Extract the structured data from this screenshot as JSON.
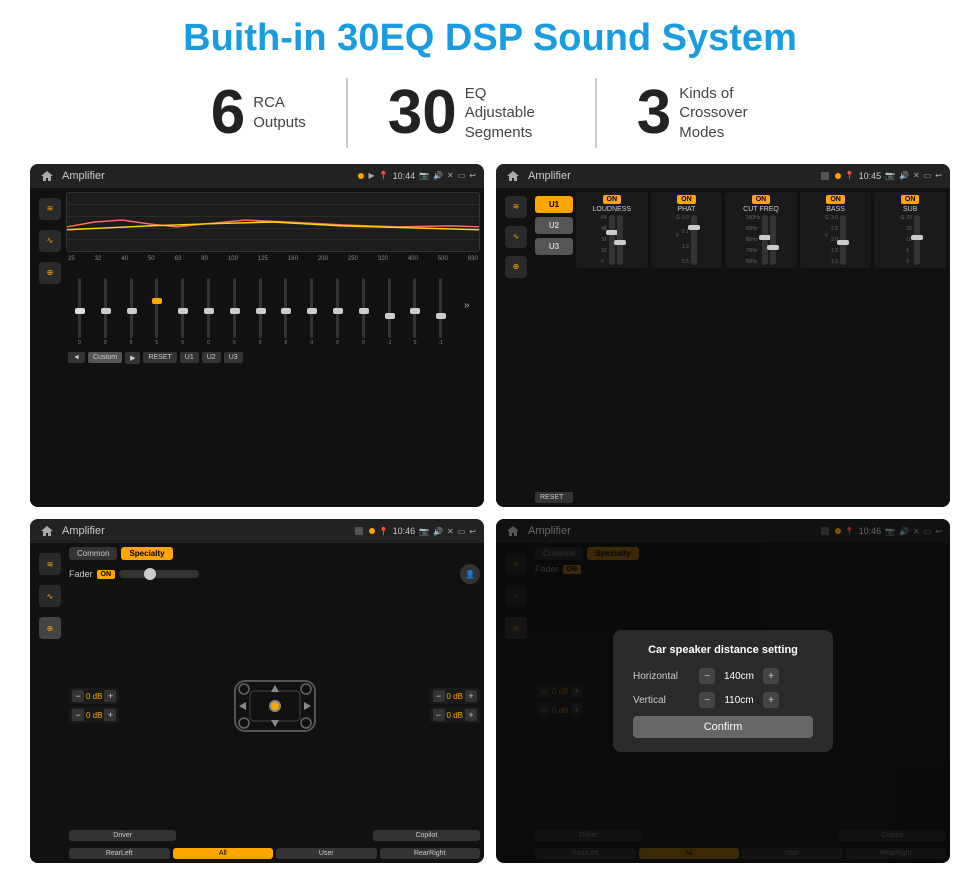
{
  "title": "Buith-in 30EQ DSP Sound System",
  "stats": [
    {
      "number": "6",
      "label": "RCA\nOutputs"
    },
    {
      "number": "30",
      "label": "EQ Adjustable\nSegments"
    },
    {
      "number": "3",
      "label": "Kinds of\nCrossover Modes"
    }
  ],
  "screens": {
    "eq": {
      "app_name": "Amplifier",
      "time": "10:44",
      "freq_labels": [
        "25",
        "32",
        "40",
        "50",
        "63",
        "80",
        "100",
        "125",
        "160",
        "200",
        "250",
        "320",
        "400",
        "500",
        "630"
      ],
      "slider_values": [
        "0",
        "0",
        "0",
        "5",
        "0",
        "0",
        "0",
        "0",
        "0",
        "0",
        "0",
        "0",
        "-1",
        "0",
        "-1"
      ],
      "controls": [
        "◄",
        "Custom",
        "►",
        "RESET",
        "U1",
        "U2",
        "U3"
      ]
    },
    "crossover": {
      "app_name": "Amplifier",
      "time": "10:45",
      "presets": [
        "U1",
        "U2",
        "U3"
      ],
      "channels": [
        {
          "on": true,
          "name": "LOUDNESS"
        },
        {
          "on": true,
          "name": "PHAT"
        },
        {
          "on": true,
          "name": "CUT FREQ"
        },
        {
          "on": true,
          "name": "BASS"
        },
        {
          "on": true,
          "name": "SUB"
        }
      ],
      "reset_btn": "RESET"
    },
    "fader": {
      "app_name": "Amplifier",
      "time": "10:46",
      "tabs": [
        "Common",
        "Specialty"
      ],
      "fader_label": "Fader",
      "fader_on": "ON",
      "ch_values": [
        "0 dB",
        "0 dB",
        "0 dB",
        "0 dB"
      ],
      "bottom_btns": [
        "Driver",
        "",
        "Copilot",
        "RearLeft",
        "All",
        "User",
        "RearRight"
      ]
    },
    "distance": {
      "app_name": "Amplifier",
      "time": "10:46",
      "tabs": [
        "Common",
        "Specialty"
      ],
      "dialog": {
        "title": "Car speaker distance setting",
        "horizontal_label": "Horizontal",
        "horizontal_value": "140cm",
        "vertical_label": "Vertical",
        "vertical_value": "110cm",
        "confirm_btn": "Confirm"
      },
      "ch_values": [
        "0 dB",
        "0 dB"
      ],
      "bottom_btns": [
        "Driver",
        "Copilot",
        "RearLeft",
        "All",
        "User",
        "RearRight"
      ]
    }
  },
  "icons": {
    "home": "⌂",
    "play": "▶",
    "pause": "⏸",
    "back": "↩",
    "pin": "📍",
    "speaker": "🔊",
    "eq_icon": "≋",
    "wave_icon": "∿",
    "surround_icon": "⊕"
  }
}
